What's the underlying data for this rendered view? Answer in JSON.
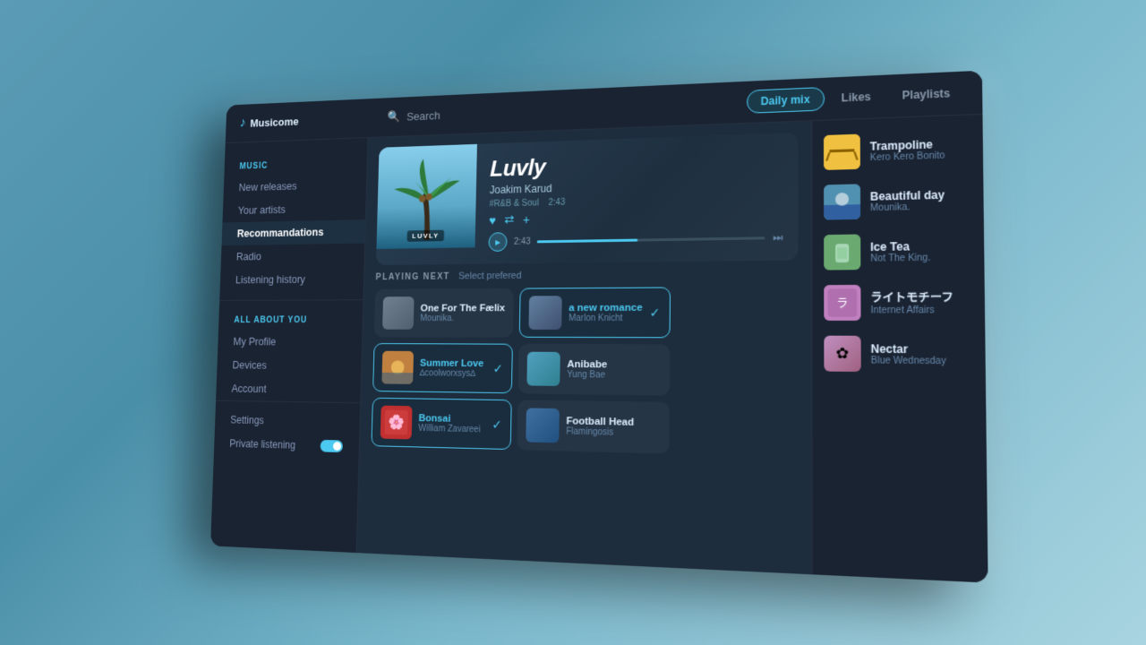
{
  "app": {
    "name": "Musicome",
    "logo_icon": "♪"
  },
  "header": {
    "search_placeholder": "Search",
    "tabs": [
      {
        "id": "daily-mix",
        "label": "Daily mix",
        "active": true
      },
      {
        "id": "likes",
        "label": "Likes",
        "active": false
      },
      {
        "id": "playlists",
        "label": "Playlists",
        "active": false
      }
    ]
  },
  "sidebar": {
    "sections": [
      {
        "label": "MUSIC",
        "items": [
          {
            "id": "new-releases",
            "label": "New releases",
            "active": false
          },
          {
            "id": "your-artists",
            "label": "Your artists",
            "active": false
          },
          {
            "id": "recommendations",
            "label": "Recommandations",
            "active": true
          },
          {
            "id": "radio",
            "label": "Radio",
            "active": false
          },
          {
            "id": "listening-history",
            "label": "Listening history",
            "active": false
          }
        ]
      },
      {
        "label": "ALL ABOUT YOU",
        "items": [
          {
            "id": "my-profile",
            "label": "My Profile",
            "active": false
          },
          {
            "id": "devices",
            "label": "Devices",
            "active": false
          },
          {
            "id": "account",
            "label": "Account",
            "active": false
          }
        ]
      }
    ],
    "footer": {
      "settings_label": "Settings",
      "private_listening_label": "Private listening",
      "private_listening_on": true
    }
  },
  "now_playing": {
    "track_title": "Luvly",
    "artist": "Joakim Karud",
    "genre": "#R&B & Soul",
    "duration": "2:43",
    "current_time": "2:43",
    "album_label": "LUVLY",
    "progress_percent": 45
  },
  "playing_next": {
    "header_label": "PLAYING NEXT",
    "select_label": "Select prefered",
    "tracks": [
      {
        "id": "one-for-the-faelix",
        "title": "One For The Fælix",
        "artist": "Mounika.",
        "selected": false,
        "highlighted": false,
        "column": 0
      },
      {
        "id": "a-new-romance",
        "title": "a new romance",
        "artist": "Marlon Knicht",
        "selected": true,
        "highlighted": true,
        "column": 1
      },
      {
        "id": "summer-love",
        "title": "Summer Love",
        "artist": "∆coolworxsys∆",
        "selected": true,
        "highlighted": true,
        "column": 0
      },
      {
        "id": "anibabe",
        "title": "Anibabe",
        "artist": "Yung Bae",
        "selected": false,
        "highlighted": false,
        "column": 1
      },
      {
        "id": "bonsai",
        "title": "Bonsai",
        "artist": "William Zavareei",
        "selected": true,
        "highlighted": true,
        "column": 0
      },
      {
        "id": "football-head",
        "title": "Football Head",
        "artist": "Flamingosis",
        "selected": false,
        "highlighted": false,
        "column": 1
      }
    ]
  },
  "daily_mix_list": [
    {
      "id": "trampoline",
      "title": "Trampoline",
      "artist": "Kero Kero Bonito",
      "thumb_color": "yellow"
    },
    {
      "id": "beautiful-day",
      "title": "Beautiful day",
      "artist": "Mounika.",
      "thumb_color": "blue"
    },
    {
      "id": "ice-tea",
      "title": "Ice Tea",
      "artist": "Not The King.",
      "thumb_color": "green"
    },
    {
      "id": "raito-motif",
      "title": "ライトモチーフ",
      "artist": "Internet Affairs",
      "thumb_color": "purple"
    },
    {
      "id": "nectar",
      "title": "Nectar",
      "artist": "Blue Wednesday",
      "thumb_color": "pink"
    }
  ],
  "colors": {
    "accent": "#4cc9f0",
    "bg_dark": "#1a2332",
    "bg_mid": "#1e2d3e",
    "text_primary": "#ddeeff",
    "text_secondary": "#8899aa"
  }
}
